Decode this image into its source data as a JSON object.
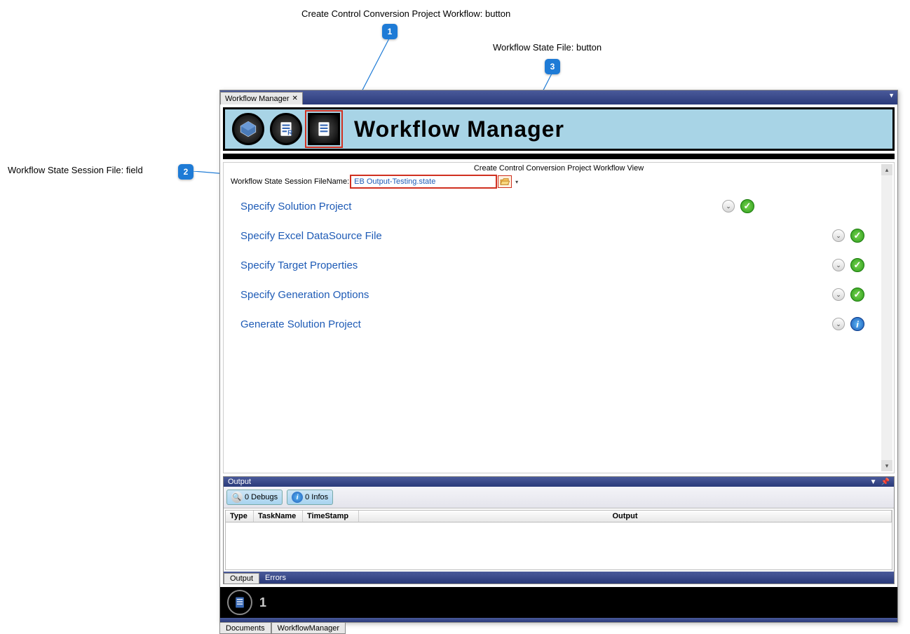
{
  "callouts": {
    "c1": {
      "label": "Create Control Conversion Project Workflow: button",
      "num": "1"
    },
    "c2": {
      "label": "Workflow State Session File: field",
      "num": "2"
    },
    "c3": {
      "label": "Workflow State File: button",
      "num": "3"
    }
  },
  "tab": {
    "title": "Workflow Manager"
  },
  "banner": {
    "title": "Workflow Manager"
  },
  "view": {
    "title": "Create Control Conversion Project Workflow View",
    "file_label": "Workflow State Session FileName:",
    "file_value": "EB Output-Testing.state"
  },
  "steps": [
    {
      "label": "Specify Solution Project",
      "status": "check",
      "narrow": true
    },
    {
      "label": "Specify Excel DataSource File",
      "status": "check",
      "narrow": false
    },
    {
      "label": "Specify Target Properties",
      "status": "check",
      "narrow": false
    },
    {
      "label": "Specify Generation Options",
      "status": "check",
      "narrow": false
    },
    {
      "label": "Generate Solution Project",
      "status": "info",
      "narrow": false
    }
  ],
  "output": {
    "title": "Output",
    "debugs": "0 Debugs",
    "infos": "0 Infos",
    "cols": {
      "type": "Type",
      "task": "TaskName",
      "time": "TimeStamp",
      "out": "Output"
    },
    "tabs": {
      "output": "Output",
      "errors": "Errors"
    }
  },
  "footer": {
    "num": "1"
  },
  "bottom_tabs": {
    "docs": "Documents",
    "wm": "WorkflowManager"
  }
}
